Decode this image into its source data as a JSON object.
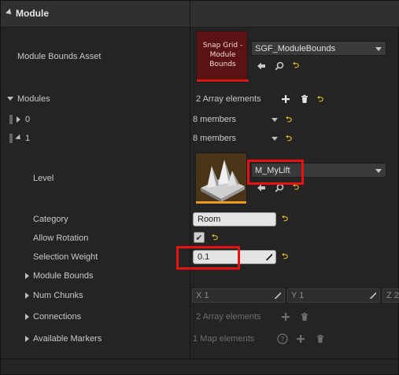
{
  "section": {
    "title": "Module"
  },
  "module_bounds_asset": {
    "label": "Module Bounds Asset",
    "thumbnail_text": "Snap Grid - Module Bounds",
    "asset_name": "SGF_ModuleBounds",
    "thumbnail_color": "#5a1212",
    "accent_color": "#d01818"
  },
  "modules": {
    "label": "Modules",
    "count_text": "2 Array elements",
    "items": [
      {
        "index": "0",
        "value": "8 members"
      },
      {
        "index": "1",
        "value": "8 members"
      }
    ]
  },
  "level": {
    "label": "Level",
    "asset_name": "M_MyLift",
    "accent_color": "#e89a20"
  },
  "category": {
    "label": "Category",
    "value": "Room"
  },
  "allow_rotation": {
    "label": "Allow Rotation",
    "checked": true,
    "check_glyph": "✔"
  },
  "selection_weight": {
    "label": "Selection Weight",
    "value": "0.1"
  },
  "module_bounds": {
    "label": "Module Bounds"
  },
  "num_chunks": {
    "label": "Num Chunks",
    "x": "X 1",
    "y": "Y 1",
    "z": "Z 2"
  },
  "connections": {
    "label": "Connections",
    "value": "2 Array elements"
  },
  "available_markers": {
    "label": "Available Markers",
    "value": "1 Map elements"
  },
  "icons": {
    "reset": "⮌",
    "help": "?",
    "plus": "✚"
  },
  "colors": {
    "highlight": "#e81010",
    "reset_yellow": "#e8c020"
  }
}
